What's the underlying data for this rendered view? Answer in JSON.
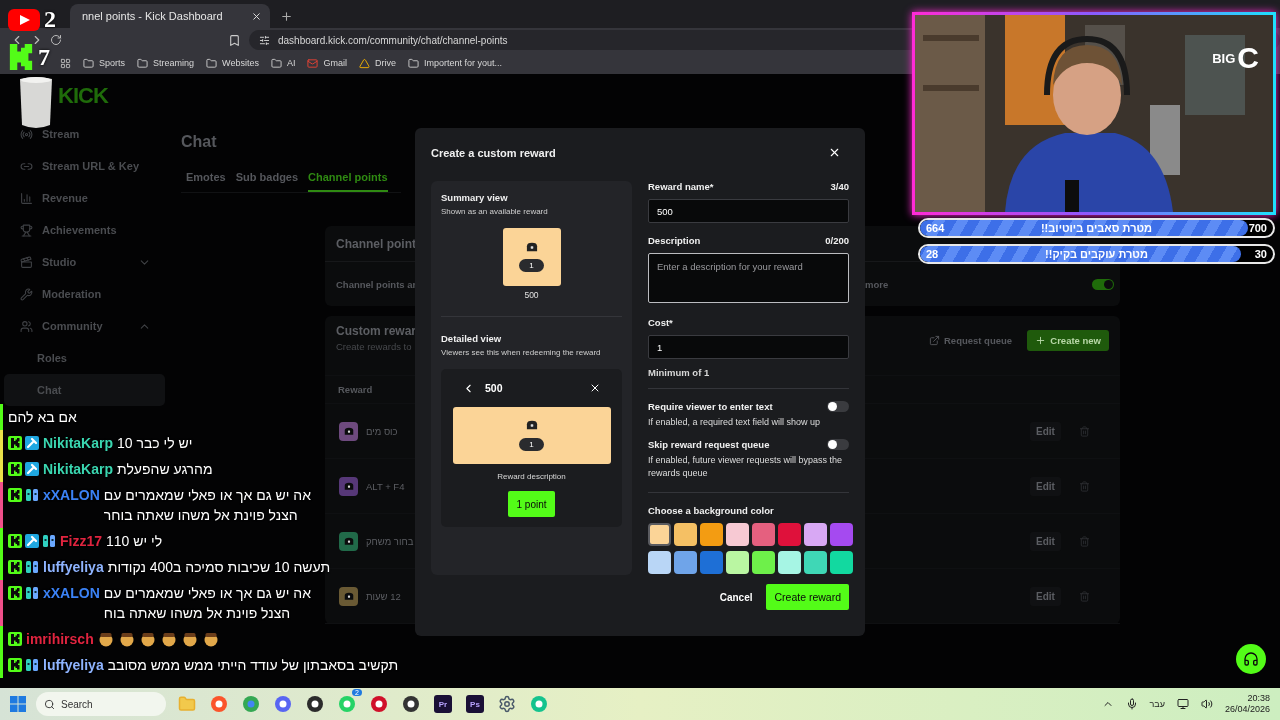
{
  "browser": {
    "tab": {
      "title": "nnel points - Kick Dashboard"
    },
    "url": "dashboard.kick.com/community/chat/channel-points",
    "bookmarks": [
      {
        "label": "Sports",
        "kind": "folder"
      },
      {
        "label": "Streaming",
        "kind": "folder"
      },
      {
        "label": "Websites",
        "kind": "folder"
      },
      {
        "label": "AI",
        "kind": "folder"
      },
      {
        "label": "Gmail",
        "kind": "mail"
      },
      {
        "label": "Drive",
        "kind": "drive"
      },
      {
        "label": "Importent for yout...",
        "kind": "folder"
      }
    ]
  },
  "stream_counters": [
    {
      "kind": "youtube",
      "count": "2"
    },
    {
      "kind": "kick",
      "count": "7"
    }
  ],
  "sidebar": {
    "logo": "KICK",
    "items": [
      {
        "label": "Stream",
        "kind": "broadcast"
      },
      {
        "label": "Stream URL & Key",
        "kind": "link"
      },
      {
        "label": "Revenue",
        "kind": "chart"
      },
      {
        "label": "Achievements",
        "kind": "trophy"
      },
      {
        "label": "Studio",
        "kind": "studio",
        "expanded": false
      },
      {
        "label": "Moderation",
        "kind": "wrench"
      },
      {
        "label": "Community",
        "kind": "people",
        "expanded": true,
        "children": [
          {
            "label": "Roles",
            "selected": false
          },
          {
            "label": "Chat",
            "selected": true
          }
        ]
      }
    ]
  },
  "page": {
    "title": "Chat",
    "tabs": [
      {
        "label": "Emotes",
        "selected": false
      },
      {
        "label": "Sub badges",
        "selected": false
      },
      {
        "label": "Channel points",
        "selected": true
      }
    ],
    "channel_points_card": {
      "title": "Channel point",
      "text": "Channel points ar",
      "link": "more",
      "enabled": true
    },
    "rewards_card": {
      "title": "Custom rewar",
      "subtitle": "Create rewards to",
      "request_queue": "Request queue",
      "create": "Create new",
      "column": "Reward",
      "rows": [
        {
          "name": "כוס מים",
          "color": "#6e4a7e",
          "edit": "Edit"
        },
        {
          "name": "ALT + F4",
          "color": "#573878",
          "edit": "Edit"
        },
        {
          "name": "בחור משחק",
          "color": "#216a49",
          "edit": "Edit"
        },
        {
          "name": "12 שעות",
          "color": "#6a5a34",
          "edit": "Edit"
        }
      ]
    }
  },
  "modal": {
    "title": "Create a custom reward",
    "summary": {
      "title": "Summary view",
      "subtitle": "Shown as an available reward",
      "cost_pill": "1",
      "name": "500"
    },
    "detail": {
      "title": "Detailed view",
      "subtitle": "Viewers see this when redeeming the reward",
      "name": "500",
      "cost_pill": "1",
      "description": "Reward description",
      "button": "1 point"
    },
    "fields": [
      {
        "kind": "input",
        "label": "Reward name*",
        "counter": "3/40",
        "value": "500"
      },
      {
        "kind": "textarea",
        "label": "Description",
        "counter": "0/200",
        "placeholder": "Enter a description for your reward"
      },
      {
        "kind": "input",
        "label": "Cost*",
        "value": "1",
        "hint": "Minimum of 1"
      }
    ],
    "options": [
      {
        "label": "Require viewer to enter text",
        "description": "If enabled, a required text field will show up",
        "on": false
      },
      {
        "label": "Skip reward request queue",
        "description": "If enabled, future viewer requests will bypass the rewards queue",
        "on": false
      }
    ],
    "color_title": "Choose a background color",
    "colors": [
      {
        "color": "#fbd497",
        "selected": true
      },
      {
        "color": "#f5c064",
        "selected": false
      },
      {
        "color": "#f39c12",
        "selected": false
      },
      {
        "color": "#f7c9d3",
        "selected": false
      },
      {
        "color": "#e5607f",
        "selected": false
      },
      {
        "color": "#df113b",
        "selected": false
      },
      {
        "color": "#d8a8f4",
        "selected": false
      },
      {
        "color": "#a54af0",
        "selected": false
      },
      {
        "color": "#b9d6f6",
        "selected": false
      },
      {
        "color": "#6fa4e9",
        "selected": false
      },
      {
        "color": "#1e6fd6",
        "selected": false
      },
      {
        "color": "#baf6a2",
        "selected": false
      },
      {
        "color": "#6ef04a",
        "selected": false
      },
      {
        "color": "#a6f5e4",
        "selected": false
      },
      {
        "color": "#3fd7b6",
        "selected": false
      },
      {
        "color": "#12d9a0",
        "selected": false
      }
    ],
    "cancel": "Cancel",
    "submit": "Create reward"
  },
  "chat": [
    {
      "message": "אם בא להם",
      "bar": {
        "color": "#53fc18"
      }
    },
    {
      "badges": [
        {
          "kind": "kick"
        },
        {
          "kind": "mod"
        }
      ],
      "name": "NikitaKarp",
      "color": "#3ad6b0",
      "message": "יש לי כבר 10",
      "bar": {
        "color": "#e8e04a"
      }
    },
    {
      "badges": [
        {
          "kind": "kick"
        },
        {
          "kind": "mod"
        }
      ],
      "name": "NikitaKarp",
      "color": "#3ad6b0",
      "message": "מהרגע שהפעלת",
      "bar": {
        "color": "#e8e04a"
      }
    },
    {
      "badges": [
        {
          "kind": "kick"
        },
        {
          "kind": "sub"
        }
      ],
      "name": "xXALON",
      "color": "#3b82f6",
      "message": "אה יש גם אך או פאלי שמאמרים עם הצנל פוינת אל משהו שאתה בוחר",
      "bar": {
        "color": "#f0508a"
      }
    },
    {
      "badges": [
        {
          "kind": "kick"
        },
        {
          "kind": "mod"
        },
        {
          "kind": "sub"
        }
      ],
      "name": "Fizz17",
      "color": "#e0243f",
      "message": "לי יש 110",
      "bar": {
        "color": "#53fc18"
      }
    },
    {
      "badges": [
        {
          "kind": "kick"
        },
        {
          "kind": "sub"
        }
      ],
      "name": "luffyeliya",
      "color": "#8fb4ff",
      "message": "תעשה 10 שכיבות סמיכה ב400 נקודות",
      "bar": {
        "color": "#53fc18"
      }
    },
    {
      "badges": [
        {
          "kind": "kick"
        },
        {
          "kind": "sub"
        }
      ],
      "name": "xXALON",
      "color": "#3b82f6",
      "message": "אה יש גם אך או פאלי שמאמרים עם הצנל פוינת אל משהו שאתה בוח",
      "bar": {
        "color": "#f0508a"
      }
    },
    {
      "badges": [
        {
          "kind": "kick"
        }
      ],
      "name": "imrihirsch",
      "color": "#e0243f",
      "emotes": [
        {
          "kind": "emote"
        },
        {
          "kind": "emote"
        },
        {
          "kind": "emote"
        },
        {
          "kind": "emote"
        },
        {
          "kind": "emote"
        },
        {
          "kind": "emote"
        }
      ],
      "bar": {
        "color": "#53fc18"
      }
    },
    {
      "badges": [
        {
          "kind": "kick"
        },
        {
          "kind": "sub"
        }
      ],
      "name": "luffyeliya",
      "color": "#8fb4ff",
      "message": "תקשיב בסאבתון של עודד הייתי ממש ממש מסובב",
      "bar": {
        "color": "#53fc18"
      }
    }
  ],
  "webcam": {
    "logo": [
      "BIG",
      "C"
    ]
  },
  "goals": [
    {
      "label": "מטרת סאבים ביוטיוב!!",
      "current": "664",
      "target": "700",
      "level": 0.93
    },
    {
      "label": "מטרת עוקבים בקיק!!",
      "current": "28",
      "target": "30",
      "level": 0.91
    }
  ],
  "taskbar": {
    "search": "Search",
    "apps": [
      {
        "kind": "explorer"
      },
      {
        "kind": "brave"
      },
      {
        "kind": "chrome"
      },
      {
        "kind": "discord"
      },
      {
        "kind": "obs"
      },
      {
        "kind": "whatsapp",
        "badge": "2"
      },
      {
        "kind": "red"
      },
      {
        "kind": "davinci"
      },
      {
        "kind": "adobe",
        "label": "Pr"
      },
      {
        "kind": "adobe",
        "label": "Ps"
      },
      {
        "kind": "settings"
      },
      {
        "kind": "green"
      }
    ],
    "language": "עבר",
    "time": "20:38",
    "date": "26/04/2026"
  }
}
